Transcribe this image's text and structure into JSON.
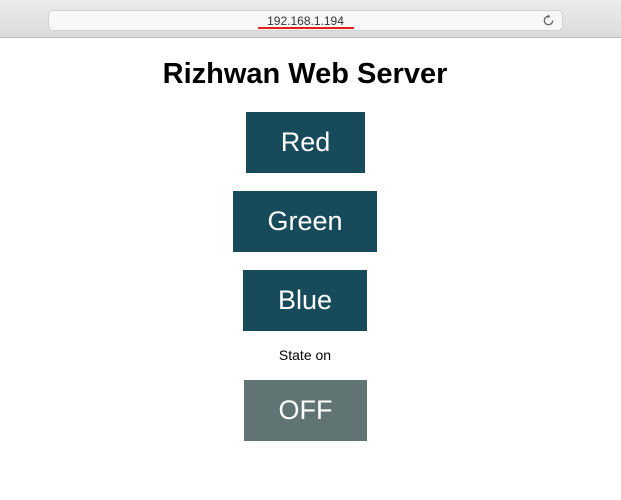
{
  "browser": {
    "url": "192.168.1.194",
    "url_underline_color": "#e02020"
  },
  "page": {
    "title": "Rizhwan Web Server",
    "buttons": [
      {
        "label": "Red",
        "color": "#174a5a"
      },
      {
        "label": "Green",
        "color": "#174a5a"
      },
      {
        "label": "Blue",
        "color": "#174a5a"
      }
    ],
    "state_text": "State on",
    "toggle": {
      "label": "OFF",
      "color": "#607474"
    }
  },
  "icons": {
    "reload": "reload-icon"
  }
}
